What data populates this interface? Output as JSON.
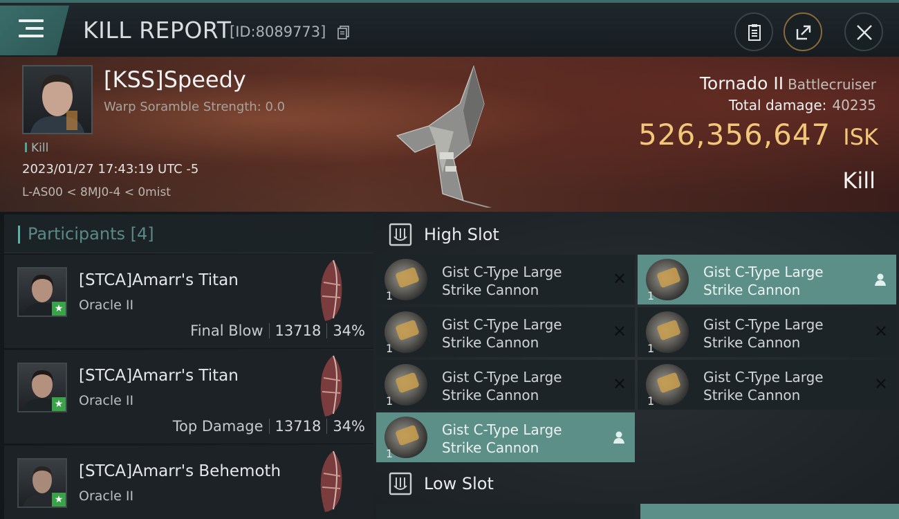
{
  "header": {
    "title": "KILL REPORT",
    "report_id": "[ID:8089773]",
    "icons": {
      "menu": "menu-icon",
      "copy": "copy-icon",
      "clipboard": "clipboard-icon",
      "share": "share-icon",
      "close": "close-icon"
    }
  },
  "victim": {
    "name": "[KSS]Speedy",
    "scramble": "Warp Soramble Strength: 0.0",
    "tag": "Kill",
    "datetime": "2023/01/27 17:43:19 UTC -5",
    "location": "L-AS00 < 8MJ0-4 < 0mist",
    "ship_name": "Tornado II",
    "ship_class": "Battlecruiser",
    "total_damage_label": "Total damage:",
    "total_damage": "40235",
    "isk_value": "526,356,647",
    "isk_unit": "ISK",
    "result": "Kill"
  },
  "participants": {
    "title": "Participants",
    "count": "[4]",
    "rows": [
      {
        "name": "[STCA]Amarr's Titan",
        "ship": "Oracle II",
        "label": "Final Blow",
        "damage": "13718",
        "percent": "34%"
      },
      {
        "name": "[STCA]Amarr's Titan",
        "ship": "Oracle II",
        "label": "Top Damage",
        "damage": "13718",
        "percent": "34%"
      },
      {
        "name": "[STCA]Amarr's Behemoth",
        "ship": "Oracle II"
      }
    ]
  },
  "fitting": {
    "high_slot_title": "High Slot",
    "low_slot_title": "Low Slot",
    "high_modules": [
      {
        "name": "Gist C-Type Large Strike Cannon",
        "qty": "1",
        "status": "destroyed"
      },
      {
        "name": "Gist C-Type Large Strike Cannon",
        "qty": "1",
        "status": "dropped"
      },
      {
        "name": "Gist C-Type Large Strike Cannon",
        "qty": "1",
        "status": "destroyed"
      },
      {
        "name": "Gist C-Type Large Strike Cannon",
        "qty": "1",
        "status": "destroyed"
      },
      {
        "name": "Gist C-Type Large Strike Cannon",
        "qty": "1",
        "status": "destroyed"
      },
      {
        "name": "Gist C-Type Large Strike Cannon",
        "qty": "1",
        "status": "destroyed"
      },
      {
        "name": "Gist C-Type Large Strike Cannon",
        "qty": "1",
        "status": "dropped"
      }
    ],
    "x_glyph": "✕",
    "colors": {
      "accent": "#5b8f88",
      "isk": "#f2c77a",
      "star": "#3aa34a"
    }
  }
}
